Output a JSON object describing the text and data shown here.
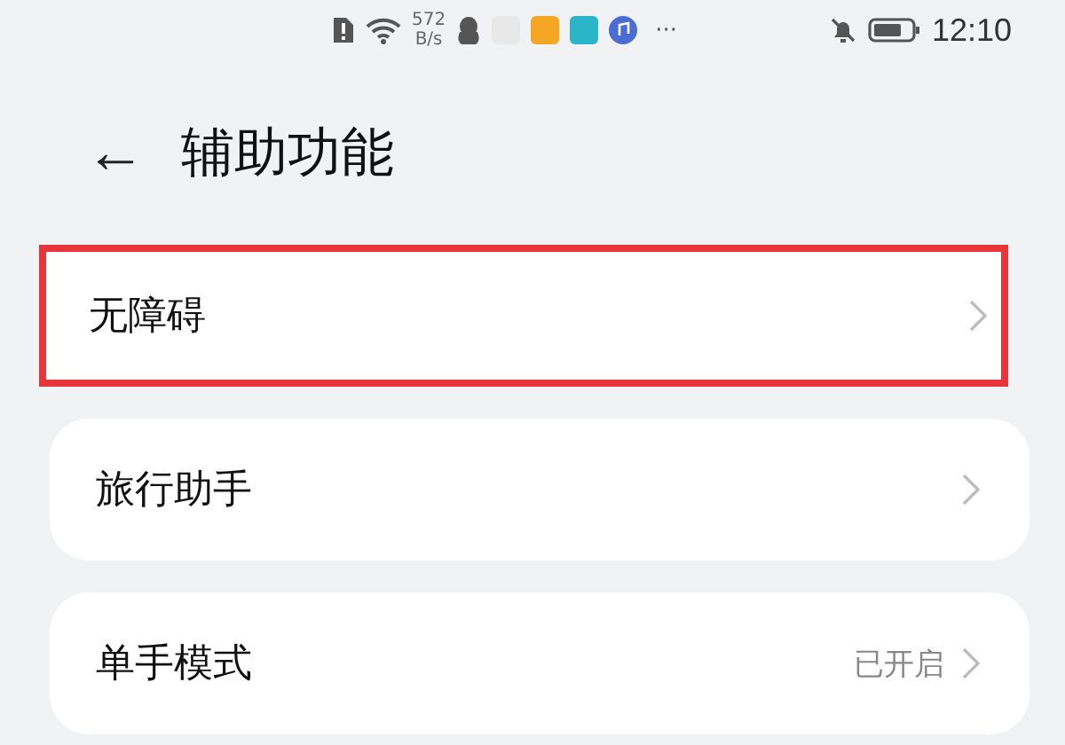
{
  "status_bar": {
    "speed_value": "572",
    "speed_unit": "B/s",
    "more": "···",
    "time": "12:10",
    "app_icons": [
      {
        "color": "#e8e8e8"
      },
      {
        "color": "#f5a623"
      },
      {
        "color": "#2bb5c8"
      }
    ]
  },
  "header": {
    "back": "←",
    "title": "辅助功能"
  },
  "items": [
    {
      "label": "无障碍",
      "value": "",
      "highlighted": true
    },
    {
      "label": "旅行助手",
      "value": "",
      "highlighted": false
    },
    {
      "label": "单手模式",
      "value": "已开启",
      "highlighted": false
    }
  ]
}
